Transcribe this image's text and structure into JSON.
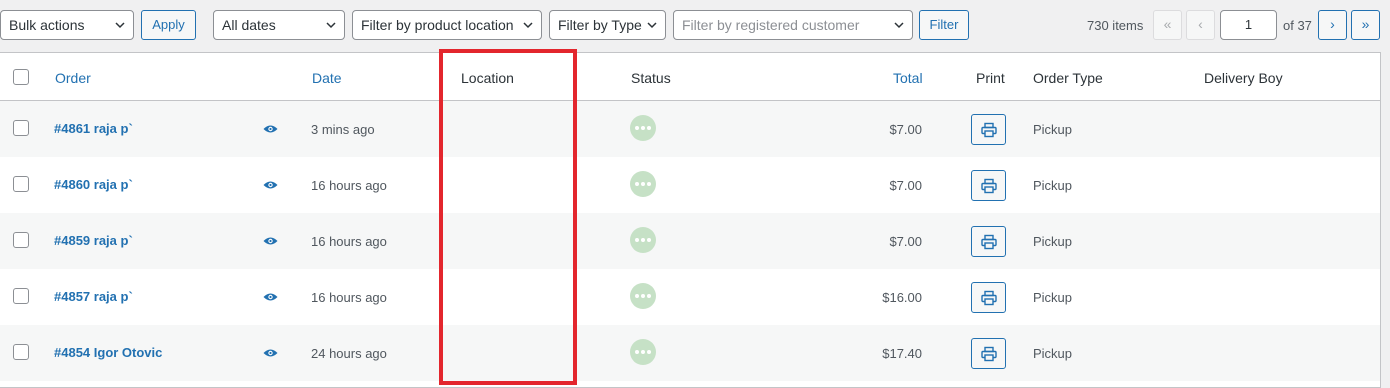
{
  "toolbar": {
    "bulk_actions": "Bulk actions",
    "apply": "Apply",
    "all_dates": "All dates",
    "filter_location": "Filter by product location",
    "filter_type": "Filter by Type",
    "filter_customer_placeholder": "Filter by registered customer",
    "filter": "Filter"
  },
  "pagination": {
    "items": "730 items",
    "first": "«",
    "prev": "‹",
    "current": "1",
    "of": "of 37",
    "next": "›",
    "last": "»"
  },
  "columns": {
    "order": "Order",
    "date": "Date",
    "location": "Location",
    "status": "Status",
    "total": "Total",
    "print": "Print",
    "order_type": "Order Type",
    "delivery_boy": "Delivery Boy"
  },
  "rows": [
    {
      "order": "#4861 raja p`",
      "date": "3 mins ago",
      "location": "",
      "total": "$7.00",
      "order_type": "Pickup",
      "delivery_boy": ""
    },
    {
      "order": "#4860 raja p`",
      "date": "16 hours ago",
      "location": "",
      "total": "$7.00",
      "order_type": "Pickup",
      "delivery_boy": ""
    },
    {
      "order": "#4859 raja p`",
      "date": "16 hours ago",
      "location": "",
      "total": "$7.00",
      "order_type": "Pickup",
      "delivery_boy": ""
    },
    {
      "order": "#4857 raja p`",
      "date": "16 hours ago",
      "location": "",
      "total": "$16.00",
      "order_type": "Pickup",
      "delivery_boy": ""
    },
    {
      "order": "#4854 Igor Otovic",
      "date": "24 hours ago",
      "location": "",
      "total": "$17.40",
      "order_type": "Pickup",
      "delivery_boy": ""
    }
  ],
  "icons": {
    "chevron": "chevron-down-icon",
    "preview": "eye-icon",
    "status": "ellipsis-icon",
    "print": "printer-icon"
  },
  "colors": {
    "link": "#2271b1",
    "status_badge": "#c6e1c6",
    "highlight": "#e3262d"
  }
}
